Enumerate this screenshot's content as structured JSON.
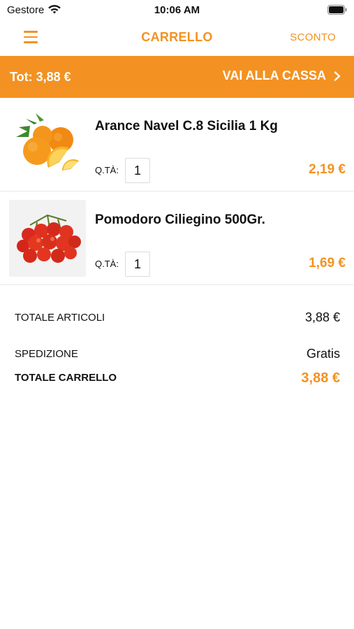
{
  "status_bar": {
    "carrier": "Gestore",
    "time": "10:06 AM"
  },
  "nav": {
    "title": "CARRELLO",
    "action_label": "SCONTO"
  },
  "checkout_bar": {
    "total_text": "Tot: 3,88 €",
    "button_label": "VAI ALLA CASSA"
  },
  "cart": {
    "qty_label": "Q.TÀ:",
    "items": [
      {
        "name": "Arance Navel C.8 Sicilia 1 Kg",
        "quantity": "1",
        "price": "2,19 €",
        "image": "oranges"
      },
      {
        "name": "Pomodoro Ciliegino 500Gr.",
        "quantity": "1",
        "price": "1,69 €",
        "image": "cherry-tomatoes"
      }
    ]
  },
  "summary": {
    "items_total_label": "TOTALE ARTICOLI",
    "items_total_value": "3,88 €",
    "shipping_label": "SPEDIZIONE",
    "shipping_value": "Gratis",
    "cart_total_label": "TOTALE CARRELLO",
    "cart_total_value": "3,88 €"
  },
  "colors": {
    "accent": "#f39222",
    "divider": "#e8e8e8"
  }
}
